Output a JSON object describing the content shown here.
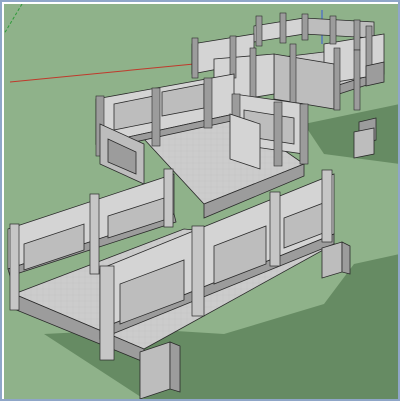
{
  "viewport": {
    "sky_color": "#e9edf2",
    "ground_color": "#8fb28a",
    "shadow_color": "#5f845c",
    "stone_light": "#d4d4d4",
    "stone_mid": "#bdbdbd",
    "stone_dark": "#9c9c9c",
    "deck_color": "#cfcfcf",
    "edge_color": "#2a2a2a",
    "axis_red": "#c0392b",
    "axis_green": "#2e9b3a",
    "axis_blue": "#3a5bd9"
  },
  "model": {
    "name_icon": "stone-bridge-model"
  }
}
